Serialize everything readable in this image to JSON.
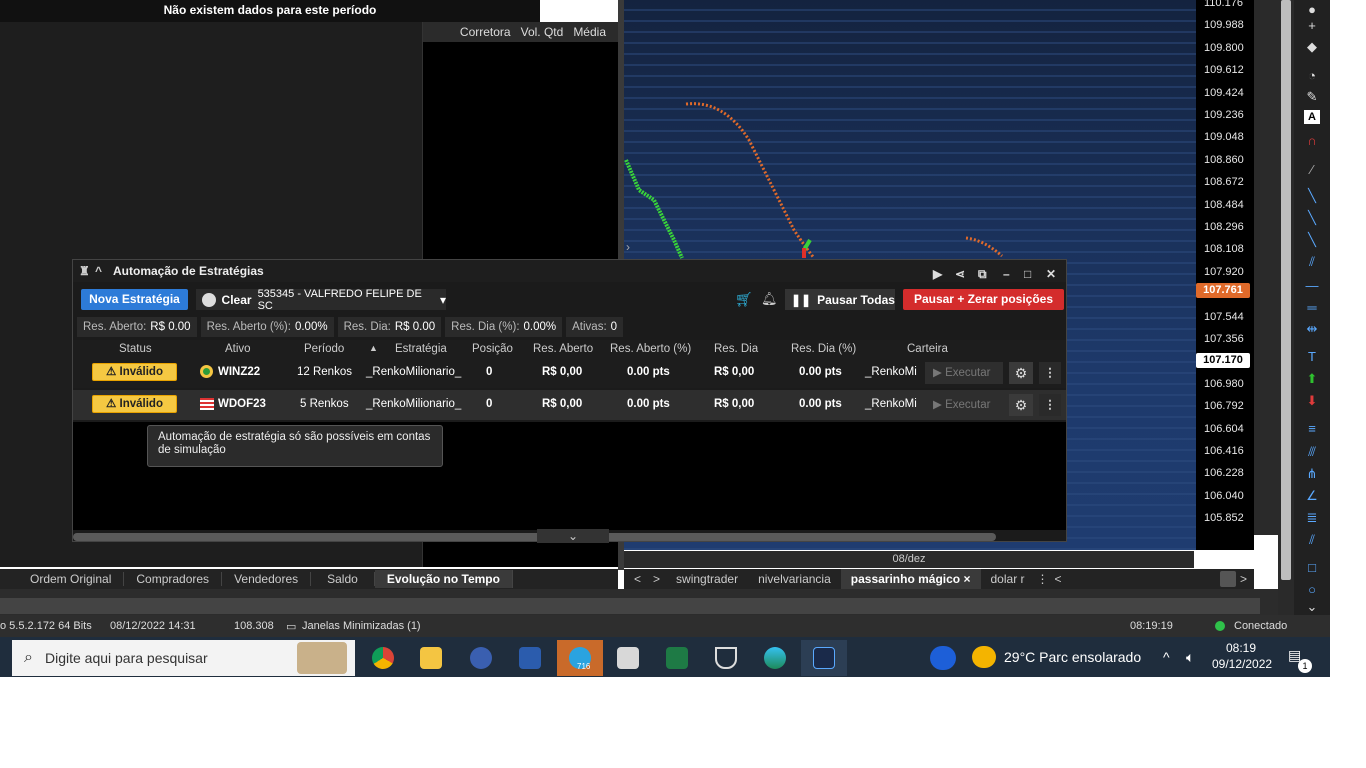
{
  "top_banner": "Não existem dados para este período",
  "book": {
    "headers": [
      "Corretora",
      "Vol. Qtd",
      "Média"
    ]
  },
  "chart": {
    "price_ticks": [
      "110.176",
      "109.988",
      "109.800",
      "109.612",
      "109.424",
      "109.236",
      "109.048",
      "108.860",
      "108.672",
      "108.484",
      "108.296",
      "108.108",
      "107.920",
      "107.544",
      "107.356",
      "106.980",
      "106.792",
      "106.604",
      "106.416",
      "106.228",
      "106.040",
      "105.852"
    ],
    "current_price": "107.761",
    "last_price": "107.170",
    "date_label": "08/dez",
    "colors": {
      "background": "#1e3a6c",
      "up": "#39d33a",
      "line": "#e06a2a"
    }
  },
  "bottom_tabs": [
    "Ordem Original",
    "Compradores",
    "Vendedores",
    "Saldo",
    "Evolução no Tempo"
  ],
  "bottom_tabs_active": "Evolução no Tempo",
  "chart_tabs": [
    "swingtrader",
    "nivelvariancia",
    "passarinho mágico",
    "dolar r"
  ],
  "chart_tabs_active": "passarinho mágico",
  "status_bar": {
    "version": "o 5.5.2.172 64 Bits",
    "datetime": "08/12/2022 14:31",
    "value": "108.308",
    "windows": "Janelas Minimizadas (1)",
    "clock": "08:19:19",
    "connection": "Conectado"
  },
  "taskbar": {
    "search_placeholder": "Digite aqui para pesquisar",
    "telegram_badge": "716",
    "weather": "29°C  Parc ensolarado",
    "time": "08:19",
    "date": "09/12/2022",
    "notifications": "1"
  },
  "automation": {
    "title": "Automação de Estratégias",
    "new_button": "Nova Estratégia",
    "account_broker": "Clear",
    "account_id": "535345 - VALFREDO FELIPE DE SC",
    "pause_all": "Pausar Todas",
    "pause_zero": "Pausar + Zerar posições",
    "summary": [
      {
        "label": "Res. Aberto:",
        "value": "R$ 0.00"
      },
      {
        "label": "Res. Aberto (%):",
        "value": "0.00%"
      },
      {
        "label": "Res. Dia:",
        "value": "R$ 0.00"
      },
      {
        "label": "Res. Dia (%):",
        "value": "0.00%"
      },
      {
        "label": "Ativas:",
        "value": "0"
      }
    ],
    "columns": [
      "Status",
      "Ativo",
      "Período",
      "Estratégia",
      "Posição",
      "Res. Aberto",
      "Res. Aberto (%)",
      "Res. Dia",
      "Res. Dia (%)",
      "Carteira"
    ],
    "rows": [
      {
        "status": "Inválido",
        "asset": "WINZ22",
        "flag": "brazil",
        "period": "12 Renkos",
        "strategy": "_RenkoMilionario_",
        "position": "0",
        "open_result": "R$ 0,00",
        "open_pct": "0.00 pts",
        "day_result": "R$ 0,00",
        "day_pct": "0.00 pts",
        "portfolio": "_RenkoMi",
        "execute": "Executar"
      },
      {
        "status": "Inválido",
        "asset": "WDOF23",
        "flag": "usa",
        "period": "5 Renkos",
        "strategy": "_RenkoMilionario_",
        "position": "0",
        "open_result": "R$ 0,00",
        "open_pct": "0.00 pts",
        "day_result": "R$ 0,00",
        "day_pct": "0.00 pts",
        "portfolio": "_RenkoMi",
        "execute": "Executar"
      }
    ],
    "tooltip": "Automação de estratégia só são possíveis em contas de simulação"
  }
}
